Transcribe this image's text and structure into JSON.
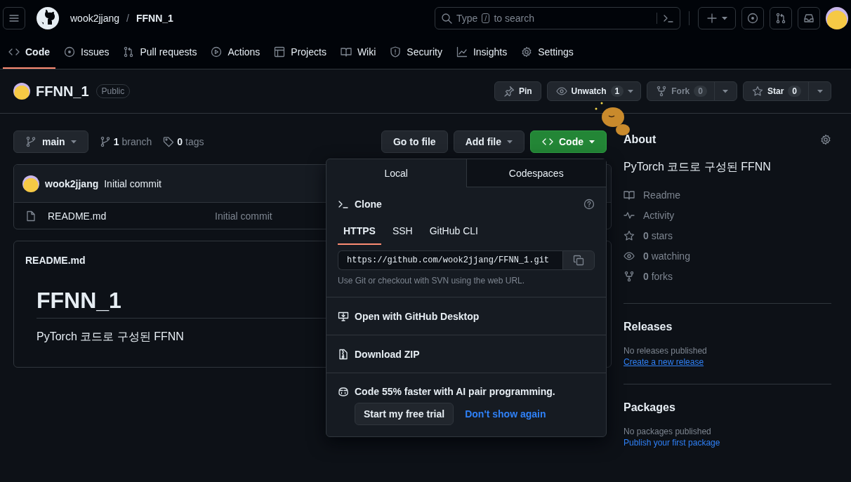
{
  "header": {
    "owner": "wook2jjang",
    "separator": "/",
    "repo": "FFNN_1",
    "search": {
      "hint": "Type",
      "key": "/",
      "hint_end": "to search"
    }
  },
  "tabs": [
    {
      "label": "Code",
      "selected": true
    },
    {
      "label": "Issues",
      "selected": false
    },
    {
      "label": "Pull requests",
      "selected": false
    },
    {
      "label": "Actions",
      "selected": false
    },
    {
      "label": "Projects",
      "selected": false
    },
    {
      "label": "Wiki",
      "selected": false
    },
    {
      "label": "Security",
      "selected": false
    },
    {
      "label": "Insights",
      "selected": false
    },
    {
      "label": "Settings",
      "selected": false
    }
  ],
  "repo_header": {
    "name": "FFNN_1",
    "visibility": "Public",
    "pin": "Pin",
    "watch": {
      "label": "Unwatch",
      "count": "1",
      "disabled": false
    },
    "fork": {
      "label": "Fork",
      "count": "0",
      "disabled": true
    },
    "star": {
      "label": "Star",
      "count": "0",
      "disabled": false
    }
  },
  "toolbar": {
    "branch": "main",
    "branches": {
      "count": "1",
      "label": "branch"
    },
    "tags": {
      "count": "0",
      "label": "tags"
    },
    "go_to_file": "Go to file",
    "add_file": "Add file",
    "code": "Code"
  },
  "files": {
    "commit": {
      "author": "wook2jjang",
      "message": "Initial commit"
    },
    "rows": [
      {
        "name": "README.md",
        "message": "Initial commit"
      }
    ]
  },
  "readme": {
    "filename": "README.md",
    "heading": "FFNN_1",
    "text": "PyTorch 코드로 구성된 FFNN"
  },
  "code_menu": {
    "tabs": [
      {
        "label": "Local",
        "selected": true
      },
      {
        "label": "Codespaces",
        "selected": false
      }
    ],
    "clone_title": "Clone",
    "protocols": [
      {
        "label": "HTTPS",
        "selected": true
      },
      {
        "label": "SSH",
        "selected": false
      },
      {
        "label": "GitHub CLI",
        "selected": false
      }
    ],
    "url": "https://github.com/wook2jjang/FFNN_1.git",
    "hint": "Use Git or checkout with SVN using the web URL.",
    "actions": [
      "Open with GitHub Desktop",
      "Download ZIP"
    ],
    "copilot": {
      "text": "Code 55% faster with AI pair programming.",
      "trial": "Start my free trial",
      "dismiss": "Don't show again"
    }
  },
  "sidebar": {
    "about_title": "About",
    "description": "PyTorch 코드로 구성된 FFNN",
    "stats": [
      {
        "label": "Readme"
      },
      {
        "label": "Activity"
      },
      {
        "count": "0",
        "label": "stars"
      },
      {
        "count": "0",
        "label": "watching"
      },
      {
        "count": "0",
        "label": "forks"
      }
    ],
    "releases": {
      "title": "Releases",
      "empty": "No releases published",
      "link": "Create a new release"
    },
    "packages": {
      "title": "Packages",
      "empty": "No packages published",
      "link": "Publish your first package"
    }
  }
}
